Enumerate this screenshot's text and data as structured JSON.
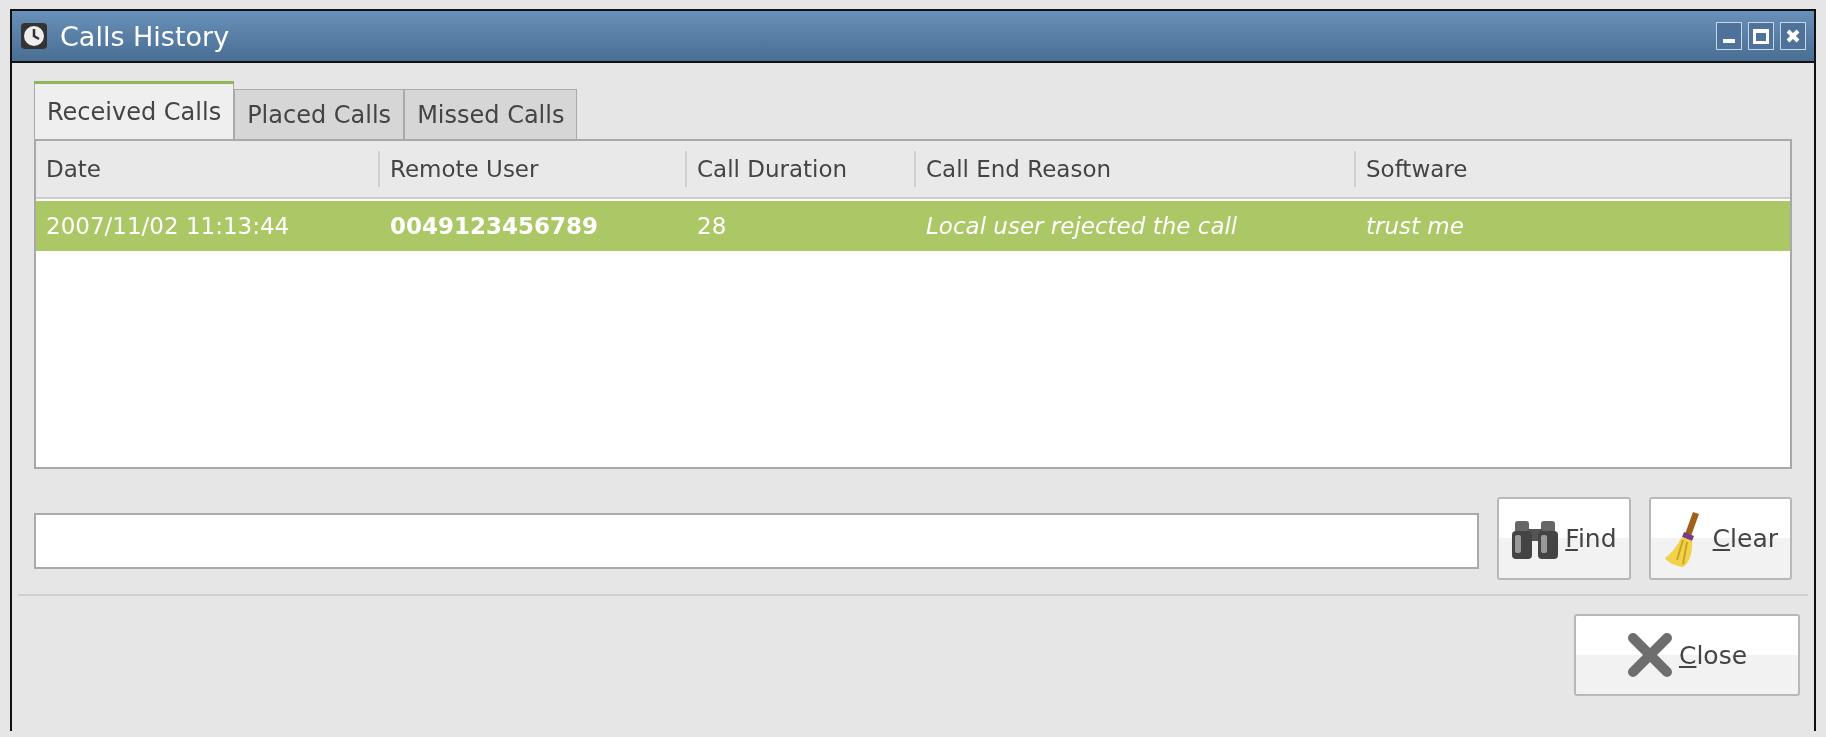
{
  "window": {
    "title": "Calls History"
  },
  "tabs": [
    {
      "label": "Received Calls",
      "selected": true
    },
    {
      "label": "Placed Calls",
      "selected": false
    },
    {
      "label": "Missed Calls",
      "selected": false
    }
  ],
  "table": {
    "columns": [
      "Date",
      "Remote User",
      "Call Duration",
      "Call End Reason",
      "Software"
    ],
    "rows": [
      {
        "date": "2007/11/02 11:13:44",
        "remote_user": "0049123456789",
        "call_duration": "28",
        "call_end_reason": "Local user rejected the call",
        "software": "trust me",
        "selected": true
      }
    ]
  },
  "buttons": [
    {
      "kind": "find",
      "label": "Find",
      "underline_first": true
    },
    {
      "kind": "clear",
      "label": "Clear",
      "underline_first": true
    }
  ],
  "footer_buttons": [
    {
      "kind": "close",
      "label": "Close",
      "underline_first": true
    }
  ]
}
